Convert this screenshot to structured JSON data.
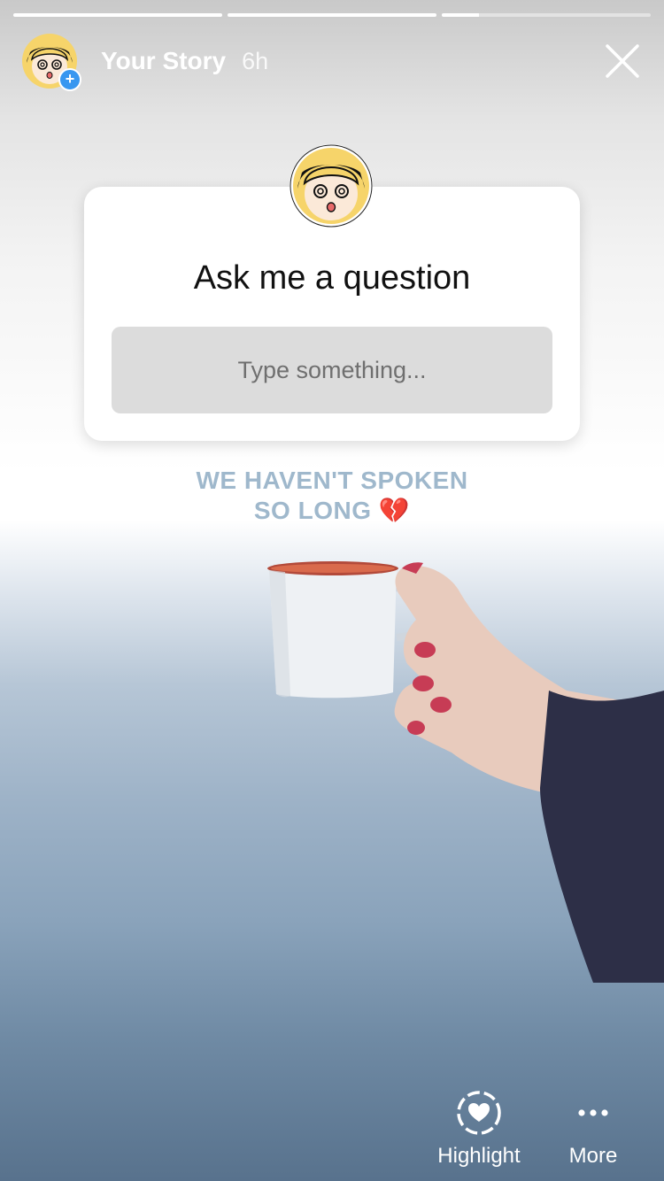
{
  "story": {
    "progress": [
      1,
      1,
      0.18
    ],
    "username": "Your Story",
    "time": "6h"
  },
  "question_sticker": {
    "title": "Ask me a question",
    "placeholder": "Type something..."
  },
  "caption": {
    "line1": "WE HAVEN'T SPOKEN",
    "line2": "SO LONG",
    "emoji": "💔"
  },
  "actions": {
    "highlight_label": "Highlight",
    "more_label": "More"
  },
  "icons": {
    "close": "close-icon",
    "plus": "plus-badge-icon",
    "highlight": "heart-circle-icon",
    "more": "ellipsis-icon"
  },
  "colors": {
    "accent": "#3897f0",
    "caption": "#9fb8cc",
    "input_bg": "#dcdcdc"
  }
}
